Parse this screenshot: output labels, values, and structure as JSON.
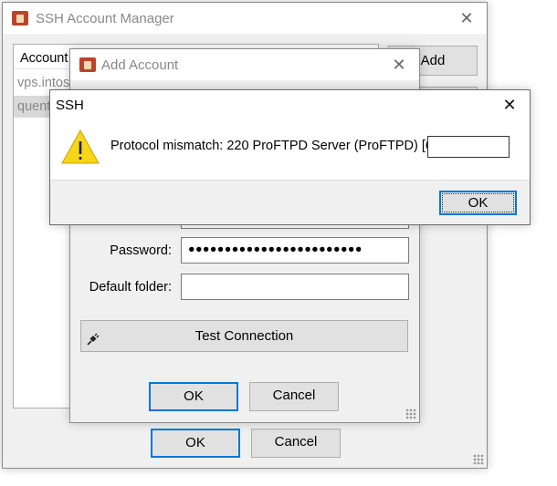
{
  "manager": {
    "title": "SSH Account Manager",
    "close_glyph": "✕",
    "column_header": "Account",
    "accounts": [
      "vps.intos",
      "quent"
    ],
    "add_label": "Add",
    "ok_label": "OK",
    "cancel_label": "Cancel"
  },
  "add_account": {
    "title": "Add Account",
    "close_glyph": "✕",
    "password_label": "Password:",
    "password_value": "●●●●●●●●●●●●●●●●●●●●●●●●",
    "default_folder_label": "Default folder:",
    "default_folder_value": "",
    "test_connection_label": "Test Connection",
    "ok_label": "OK",
    "cancel_label": "Cancel"
  },
  "ssh_dialog": {
    "title": "SSH",
    "close_glyph": "✕",
    "message": "Protocol mismatch: 220 ProFTPD Server (ProFTPD) [6",
    "warning_glyph": "!",
    "ok_label": "OK"
  },
  "colors": {
    "focus_border": "#0078d7",
    "warning_yellow": "#f7d51a",
    "selection_gray": "#d9d9d9"
  },
  "icons": {
    "app": "padlock-app-icon",
    "warning": "warning-triangle-icon",
    "plug": "plug-icon"
  }
}
